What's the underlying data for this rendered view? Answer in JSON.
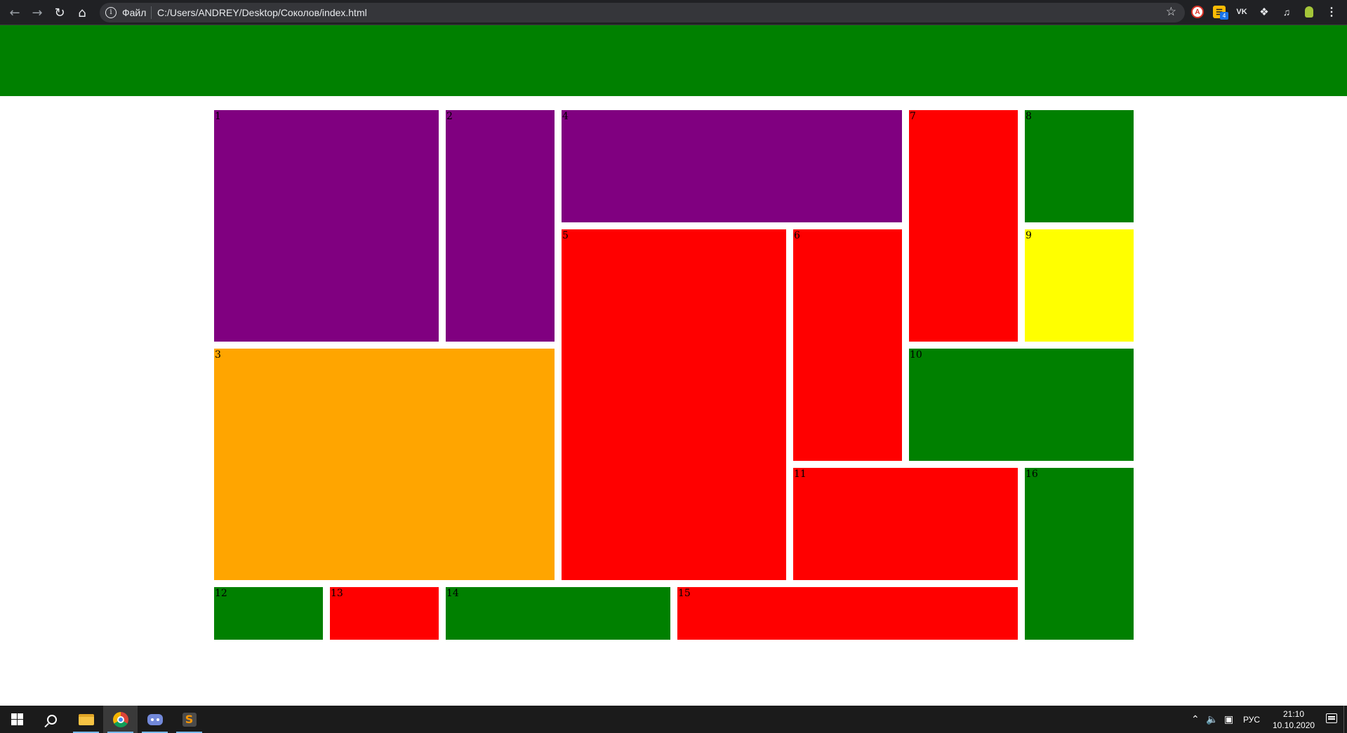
{
  "browser": {
    "back_icon": "arrow-left-icon",
    "forward_icon": "arrow-right-icon",
    "reload_icon": "reload-icon",
    "home_icon": "home-icon",
    "site_info_label": "Файл",
    "url": "C:/Users/ANDREY/Desktop/Соколов/index.html",
    "extensions": [
      "adblock-icon",
      "notes-icon",
      "vk-icon",
      "puzzle-icon",
      "playlist-icon",
      "android-icon"
    ],
    "ext_badge": "4",
    "vk_label": "VK"
  },
  "page": {
    "header_color": "#008000",
    "cells": [
      {
        "label": "1",
        "color": "#800080"
      },
      {
        "label": "2",
        "color": "#800080"
      },
      {
        "label": "3",
        "color": "#ffa500"
      },
      {
        "label": "4",
        "color": "#800080"
      },
      {
        "label": "5",
        "color": "#ff0000"
      },
      {
        "label": "6",
        "color": "#ff0000"
      },
      {
        "label": "7",
        "color": "#ff0000"
      },
      {
        "label": "8",
        "color": "#008000"
      },
      {
        "label": "9",
        "color": "#ffff00"
      },
      {
        "label": "10",
        "color": "#008000"
      },
      {
        "label": "11",
        "color": "#ff0000"
      },
      {
        "label": "12",
        "color": "#008000"
      },
      {
        "label": "13",
        "color": "#ff0000"
      },
      {
        "label": "14",
        "color": "#008000"
      },
      {
        "label": "15",
        "color": "#ff0000"
      },
      {
        "label": "16",
        "color": "#008000"
      }
    ]
  },
  "taskbar": {
    "apps": [
      "start-icon",
      "search-icon",
      "file-explorer-icon",
      "chrome-icon",
      "discord-icon",
      "sublime-text-icon"
    ],
    "language": "РУС",
    "time": "21:10",
    "date": "10.10.2020"
  }
}
